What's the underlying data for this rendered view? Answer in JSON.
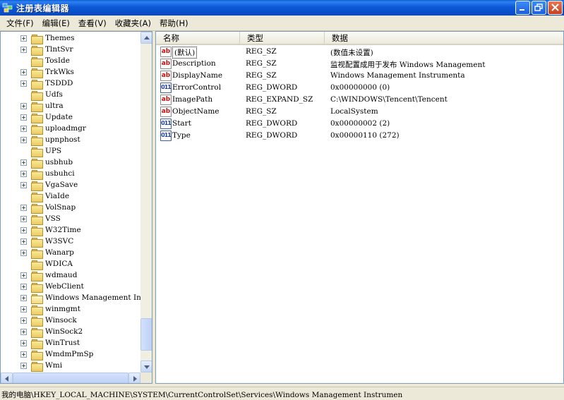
{
  "window": {
    "title": "注册表编辑器"
  },
  "menu": [
    "文件(F)",
    "编辑(E)",
    "查看(V)",
    "收藏夹(A)",
    "帮助(H)"
  ],
  "tree": {
    "items": [
      {
        "label": "Themes",
        "expander": true
      },
      {
        "label": "TlntSvr",
        "expander": true
      },
      {
        "label": "TosIde",
        "expander": false
      },
      {
        "label": "TrkWks",
        "expander": true
      },
      {
        "label": "TSDDD",
        "expander": true
      },
      {
        "label": "Udfs",
        "expander": false
      },
      {
        "label": "ultra",
        "expander": true
      },
      {
        "label": "Update",
        "expander": true
      },
      {
        "label": "uploadmgr",
        "expander": true
      },
      {
        "label": "upnphost",
        "expander": true
      },
      {
        "label": "UPS",
        "expander": false
      },
      {
        "label": "usbhub",
        "expander": true
      },
      {
        "label": "usbuhci",
        "expander": true
      },
      {
        "label": "VgaSave",
        "expander": true
      },
      {
        "label": "ViaIde",
        "expander": false
      },
      {
        "label": "VolSnap",
        "expander": true
      },
      {
        "label": "VSS",
        "expander": true
      },
      {
        "label": "W32Time",
        "expander": true
      },
      {
        "label": "W3SVC",
        "expander": true
      },
      {
        "label": "Wanarp",
        "expander": true
      },
      {
        "label": "WDICA",
        "expander": false
      },
      {
        "label": "wdmaud",
        "expander": true
      },
      {
        "label": "WebClient",
        "expander": true
      },
      {
        "label": "Windows Management Ins",
        "expander": true,
        "selected": true
      },
      {
        "label": "winmgmt",
        "expander": true
      },
      {
        "label": "Winsock",
        "expander": true
      },
      {
        "label": "WinSock2",
        "expander": true
      },
      {
        "label": "WinTrust",
        "expander": true
      },
      {
        "label": "WmdmPmSp",
        "expander": true
      },
      {
        "label": "Wmi",
        "expander": true
      }
    ]
  },
  "list": {
    "headers": {
      "name": "名称",
      "type": "类型",
      "data": "数据"
    },
    "rows": [
      {
        "icon": "string-value-icon",
        "kind": "sz",
        "name": "(默认)",
        "type": "REG_SZ",
        "data": "(数值未设置)"
      },
      {
        "icon": "string-value-icon",
        "kind": "sz",
        "name": "Description",
        "type": "REG_SZ",
        "data": "监视配置成用于发布 Windows Management"
      },
      {
        "icon": "string-value-icon",
        "kind": "sz",
        "name": "DisplayName",
        "type": "REG_SZ",
        "data": "Windows Management Instrumenta"
      },
      {
        "icon": "binary-value-icon",
        "kind": "bin",
        "name": "ErrorControl",
        "type": "REG_DWORD",
        "data": "0x00000000 (0)"
      },
      {
        "icon": "string-value-icon",
        "kind": "sz",
        "name": "ImagePath",
        "type": "REG_EXPAND_SZ",
        "data": "C:\\WINDOWS\\Tencent\\Tencent"
      },
      {
        "icon": "string-value-icon",
        "kind": "sz",
        "name": "ObjectName",
        "type": "REG_SZ",
        "data": "LocalSystem"
      },
      {
        "icon": "binary-value-icon",
        "kind": "bin",
        "name": "Start",
        "type": "REG_DWORD",
        "data": "0x00000002 (2)"
      },
      {
        "icon": "binary-value-icon",
        "kind": "bin",
        "name": "Type",
        "type": "REG_DWORD",
        "data": "0x00000110 (272)"
      }
    ]
  },
  "status": {
    "path": "我的电脑\\HKEY_LOCAL_MACHINE\\SYSTEM\\CurrentControlSet\\Services\\Windows Management Instrumen"
  }
}
